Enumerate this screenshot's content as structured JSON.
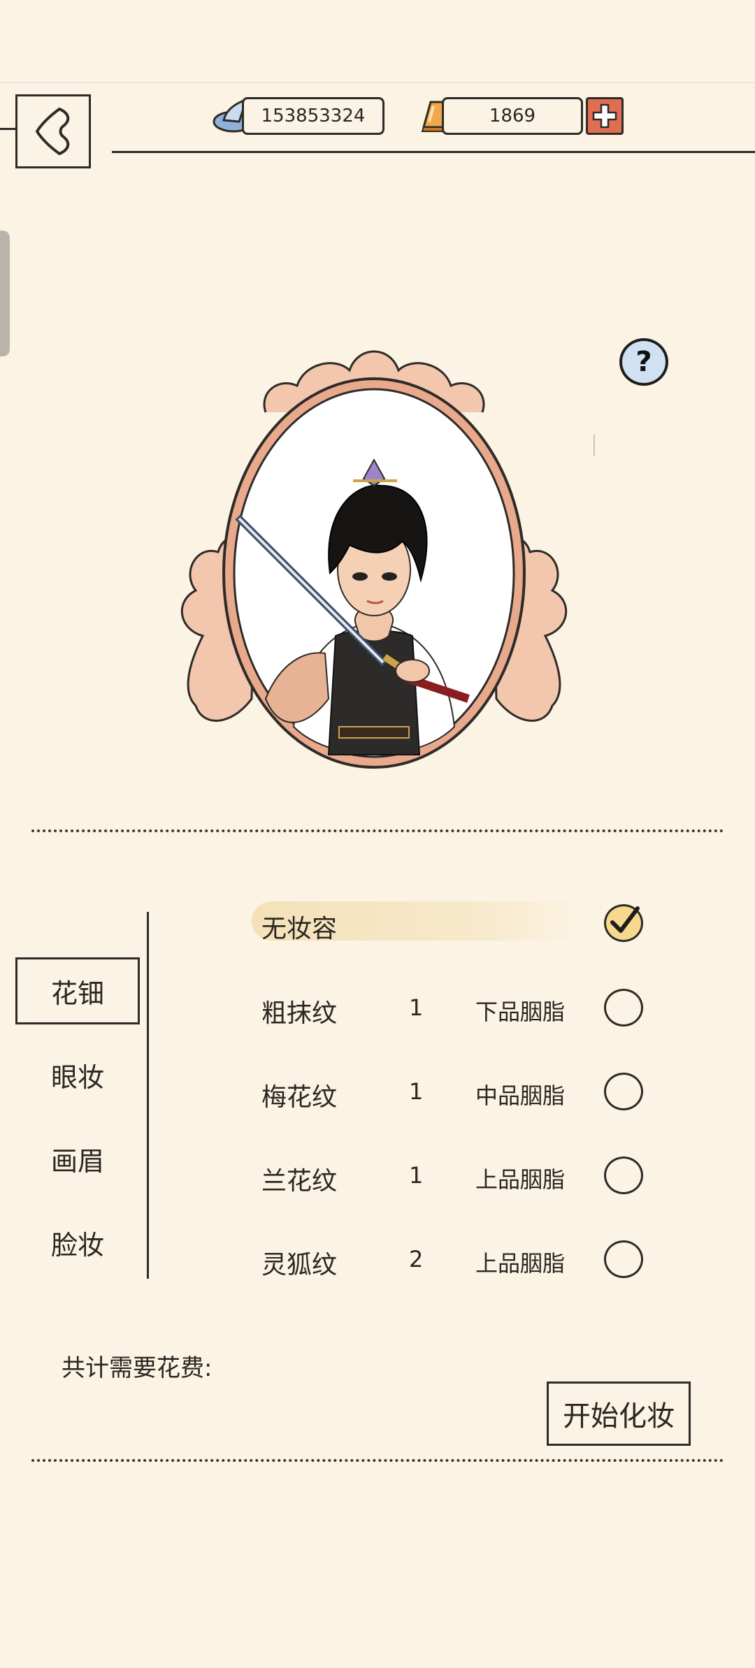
{
  "header": {
    "silver_icon": "silver-ingot-icon",
    "silver_value": "153853324",
    "gold_icon": "gold-bar-icon",
    "gold_value": "1869",
    "plus_icon": "plus-icon",
    "back_icon": "back-arrow-icon"
  },
  "help": {
    "label": "?"
  },
  "tabs": [
    {
      "label": "花钿",
      "active": true
    },
    {
      "label": "眼妆",
      "active": false
    },
    {
      "label": "画眉",
      "active": false
    },
    {
      "label": "脸妆",
      "active": false
    }
  ],
  "options": [
    {
      "name": "无妆容",
      "count": "",
      "cost": "",
      "selected": true
    },
    {
      "name": "粗抹纹",
      "count": "1",
      "cost": "下品胭脂",
      "selected": false
    },
    {
      "name": "梅花纹",
      "count": "1",
      "cost": "中品胭脂",
      "selected": false
    },
    {
      "name": "兰花纹",
      "count": "1",
      "cost": "上品胭脂",
      "selected": false
    },
    {
      "name": "灵狐纹",
      "count": "2",
      "cost": "上品胭脂",
      "selected": false
    }
  ],
  "footer": {
    "total_label": "共计需要花费:",
    "start_button": "开始化妆"
  },
  "colors": {
    "background": "#fbf3e3",
    "accent_plus": "#e06f52",
    "help_bg": "#cfe1f3",
    "frame": "#e8a98c"
  }
}
